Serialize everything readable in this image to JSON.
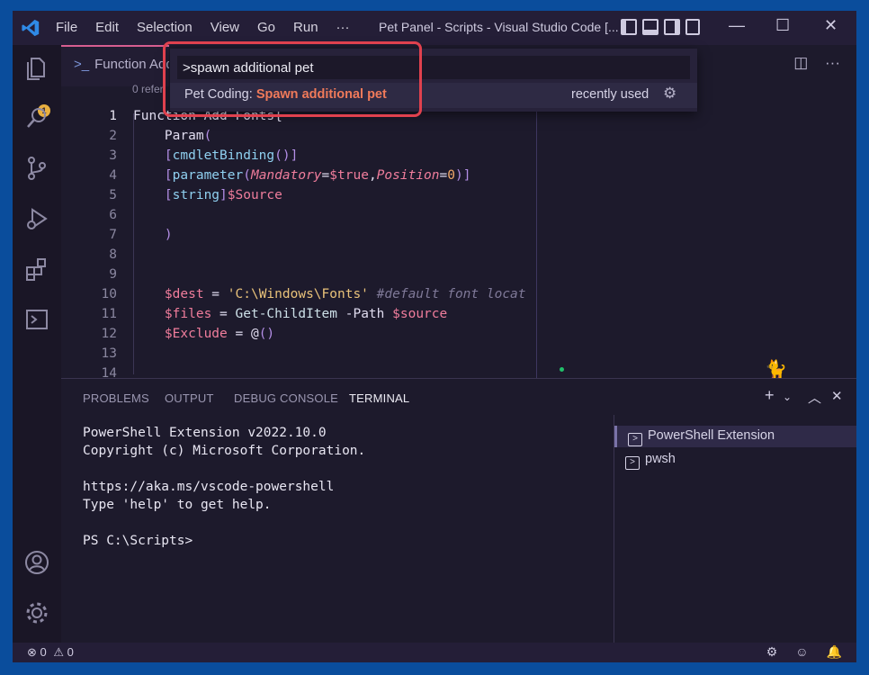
{
  "titlebar": {
    "menu": [
      "File",
      "Edit",
      "Selection",
      "View",
      "Go",
      "Run",
      "···"
    ],
    "title": "Pet Panel - Scripts - Visual Studio Code [..."
  },
  "activity_bar": {
    "items": [
      "explorer-icon",
      "search-icon",
      "source-control-icon",
      "run-debug-icon",
      "extensions-icon",
      "powershell-icon"
    ],
    "bottom": [
      "account-icon",
      "manage-gear-icon"
    ],
    "badge": "1"
  },
  "editor": {
    "tab_label": "Function Add",
    "breadcrumb": "0 refer",
    "lines": [
      {
        "n": "1",
        "segments": [
          [
            "kw",
            "Function Add-Fonts{"
          ]
        ]
      },
      {
        "n": "2",
        "segments": [
          [
            "kw",
            "    Param"
          ],
          [
            "br",
            "("
          ]
        ]
      },
      {
        "n": "3",
        "segments": [
          [
            "br",
            "    ["
          ],
          [
            "typ",
            "cmdletBinding"
          ],
          [
            "br",
            "()]"
          ]
        ]
      },
      {
        "n": "4",
        "segments": [
          [
            "br",
            "    ["
          ],
          [
            "typ",
            "parameter"
          ],
          [
            "br",
            "("
          ],
          [
            "param",
            "Mandatory"
          ],
          [
            "kw",
            "="
          ],
          [
            "var",
            "$true"
          ],
          [
            "kw",
            ","
          ],
          [
            "param",
            "Position"
          ],
          [
            "kw",
            "="
          ],
          [
            "num",
            "0"
          ],
          [
            "br",
            ")]"
          ]
        ]
      },
      {
        "n": "5",
        "segments": [
          [
            "br",
            "    ["
          ],
          [
            "typ",
            "string"
          ],
          [
            "br",
            "]"
          ],
          [
            "var",
            "$Source"
          ]
        ]
      },
      {
        "n": "6",
        "segments": []
      },
      {
        "n": "7",
        "segments": [
          [
            "br",
            "    )"
          ]
        ]
      },
      {
        "n": "8",
        "segments": []
      },
      {
        "n": "9",
        "segments": []
      },
      {
        "n": "10",
        "segments": [
          [
            "var",
            "    $dest"
          ],
          [
            "kw",
            " = "
          ],
          [
            "str",
            "'C:\\Windows\\Fonts'"
          ],
          [
            "cmt",
            " #default font locat"
          ]
        ]
      },
      {
        "n": "11",
        "segments": [
          [
            "var",
            "    $files"
          ],
          [
            "kw",
            " = "
          ],
          [
            "cmd",
            "Get-ChildItem"
          ],
          [
            "kw",
            " -Path "
          ],
          [
            "var",
            "$source"
          ]
        ]
      },
      {
        "n": "12",
        "segments": [
          [
            "var",
            "    $Exclude"
          ],
          [
            "kw",
            " = @"
          ],
          [
            "br",
            "()"
          ]
        ]
      },
      {
        "n": "13",
        "segments": []
      },
      {
        "n": "14",
        "segments": []
      }
    ]
  },
  "command_palette": {
    "input_value": ">spawn additional pet",
    "item_prefix": "Pet Coding: ",
    "item_highlight": "Spawn additional pet",
    "item_detail": "recently used"
  },
  "panel": {
    "tabs": [
      "PROBLEMS",
      "OUTPUT",
      "DEBUG CONSOLE",
      "TERMINAL"
    ],
    "active_tab": "TERMINAL",
    "terminal_output": "PowerShell Extension v2022.10.0\nCopyright (c) Microsoft Corporation.\n\nhttps://aka.ms/vscode-powershell\nType 'help' to get help.\n\nPS C:\\Scripts>",
    "terminals": [
      "PowerShell Extension",
      "pwsh"
    ]
  },
  "status_bar": {
    "errors": "0",
    "warnings": "0"
  },
  "colors": {
    "highlight_box": "#e0414e",
    "accent": "#d65e90"
  }
}
